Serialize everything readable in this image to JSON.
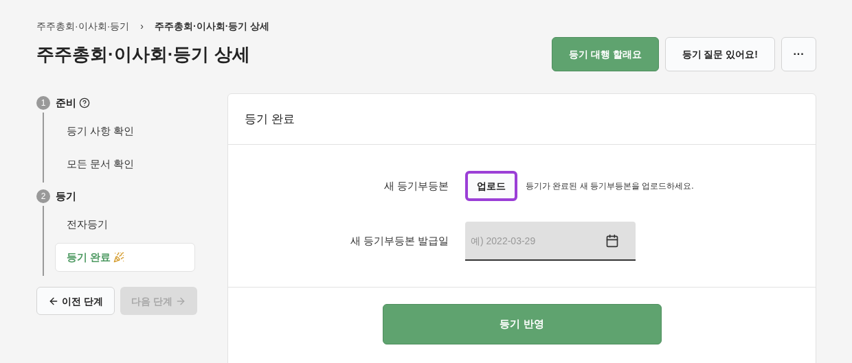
{
  "breadcrumb": [
    {
      "label": "주주총회·이사회·등기",
      "current": false
    },
    {
      "label": "주주총회·이사회·등기 상세",
      "current": true
    }
  ],
  "breadcrumb_separator": "›",
  "title": "주주총회·이사회·등기 상세",
  "actions": [
    {
      "kind": "primary",
      "label": "등기 대행 할래요"
    },
    {
      "kind": "secondary",
      "label": "등기 질문 있어요!"
    },
    {
      "kind": "more",
      "label": "···"
    }
  ],
  "steps": [
    {
      "number": "1",
      "label": "준비",
      "help": true,
      "children": [
        {
          "label": "등기 사항 확인",
          "selected": false,
          "celebrate": false
        },
        {
          "label": "모든 문서 확인",
          "selected": false,
          "celebrate": false
        }
      ]
    },
    {
      "number": "2",
      "label": "등기",
      "help": false,
      "children": [
        {
          "label": "전자등기",
          "selected": false,
          "celebrate": false
        },
        {
          "label": "등기 완료",
          "selected": true,
          "celebrate": true
        }
      ]
    }
  ],
  "nav": [
    {
      "kind": "prev",
      "label": "이전 단계",
      "disabled": false
    },
    {
      "kind": "next",
      "label": "다음 단계",
      "disabled": true
    }
  ],
  "panel": {
    "title": "등기 완료",
    "fields": [
      {
        "kind": "upload",
        "label": "새 등기부등본",
        "button": "업로드",
        "focused": true,
        "hint": "등기가 완료된 새 등기부등본을 업로드하세요."
      },
      {
        "kind": "date",
        "label": "새 등기부등본 발급일",
        "placeholder": "예) 2022-03-29"
      }
    ],
    "submit": "등기 반영"
  }
}
